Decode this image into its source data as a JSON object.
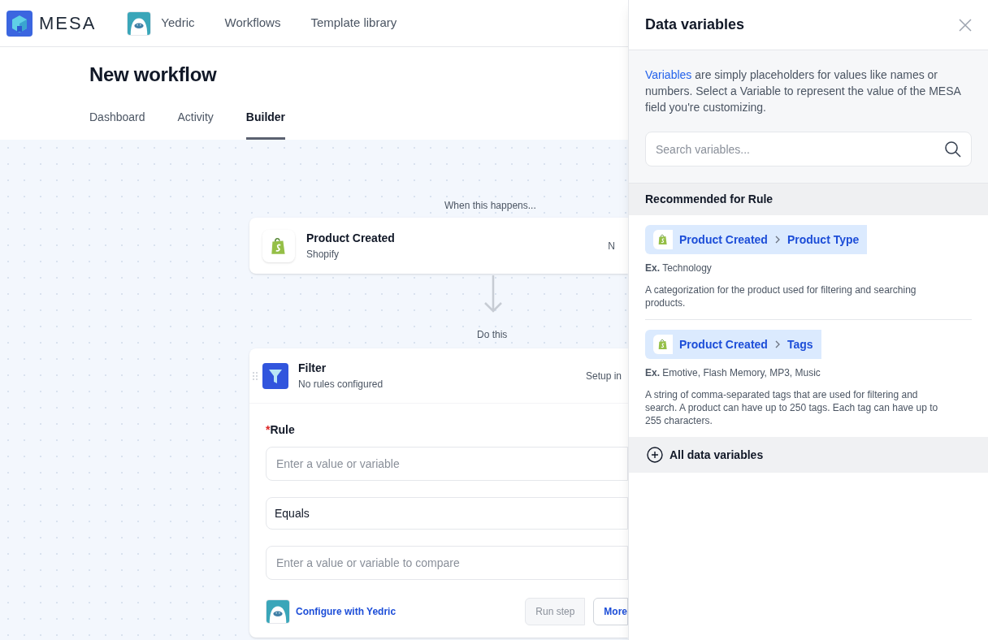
{
  "nav": {
    "logo": "MESA",
    "items": [
      {
        "label": "Yedric",
        "kind": "avatar"
      },
      {
        "label": "Workflows",
        "kind": "link"
      },
      {
        "label": "Template library",
        "kind": "link"
      }
    ]
  },
  "page": {
    "title": "New workflow",
    "tabs": [
      {
        "label": "Dashboard",
        "selected": false
      },
      {
        "label": "Activity",
        "selected": false
      },
      {
        "label": "Builder",
        "selected": true
      }
    ]
  },
  "canvas": {
    "trigger_label": "When this happens...",
    "trigger": {
      "title": "Product Created",
      "subtitle": "Shopify",
      "status": "N"
    },
    "action_label": "Do this",
    "action": {
      "title": "Filter",
      "subtitle": "No rules configured",
      "status": "Setup in",
      "rule_label": "Rule",
      "required": true,
      "required_mark": "*",
      "fields": [
        {
          "kind": "input",
          "placeholder": "Enter a value or variable"
        },
        {
          "kind": "select",
          "value": "Equals"
        },
        {
          "kind": "input",
          "placeholder": "Enter a value or variable to compare"
        }
      ],
      "assistant_link": "Configure with Yedric",
      "buttons": [
        {
          "label": "Run step",
          "disabled": true
        },
        {
          "label": "More",
          "disabled": false
        }
      ]
    }
  },
  "drawer": {
    "title": "Data variables",
    "intro_link": "Variables",
    "intro": " are simply placeholders for values like names or numbers. Select a Variable to represent the value of the MESA field you're customizing.",
    "search": {
      "placeholder": "Search variables..."
    },
    "section": "Recommended for Rule",
    "variables": [
      {
        "source": "Product Created",
        "field": "Product Type",
        "example_label": "Ex.",
        "example": "Technology",
        "description": "A categorization for the product used for filtering and searching products."
      },
      {
        "source": "Product Created",
        "field": "Tags",
        "example_label": "Ex.",
        "example": "Emotive, Flash Memory, MP3, Music",
        "description": "A string of comma-separated tags that are used for filtering and search. A product can have up to 250 tags. Each tag can have up to 255 characters."
      }
    ],
    "all_link": "All data variables"
  }
}
